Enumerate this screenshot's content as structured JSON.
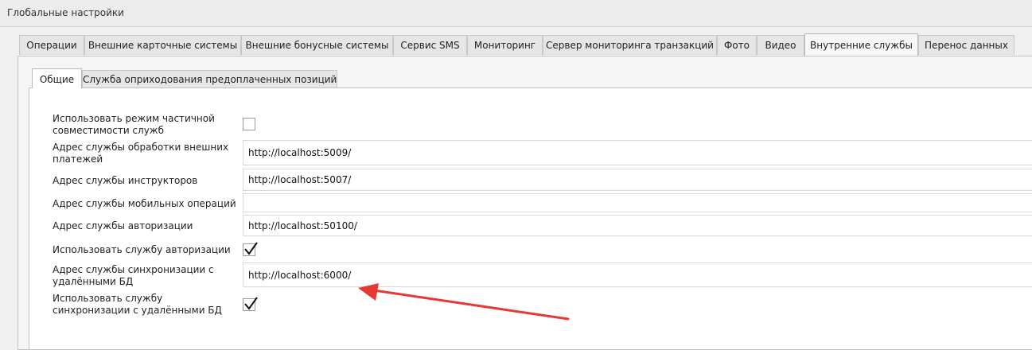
{
  "window": {
    "title": "Глобальные настройки"
  },
  "outer_tabs": [
    "Операции",
    "Внешние карточные системы",
    "Внешние бонусные системы",
    "Сервис SMS",
    "Мониторинг",
    "Сервер мониторинга транзакций",
    "Фото",
    "Видео",
    "Внутренние службы",
    "Перенос данных"
  ],
  "active_outer_tab": "Внутренние службы",
  "inner_tabs": [
    "Общие",
    "Служба оприходования предоплаченных позиций"
  ],
  "active_inner_tab": "Общие",
  "form": {
    "partial_compat": {
      "label": "Использовать режим частичной совместимости служб",
      "checked": false
    },
    "ext_payments": {
      "label": "Адрес службы обработки внешних платежей",
      "value": "http://localhost:5009/"
    },
    "instructors": {
      "label": "Адрес службы инструкторов",
      "value": "http://localhost:5007/"
    },
    "mobile_ops": {
      "label": "Адрес службы мобильных операций",
      "value": ""
    },
    "auth": {
      "label": "Адрес службы авторизации",
      "value": "http://localhost:50100/"
    },
    "use_auth": {
      "label": "Использовать службу авторизации",
      "checked": true
    },
    "sync": {
      "label": "Адрес службы синхронизации с удалёнными БД",
      "value": "http://localhost:6000/"
    },
    "use_sync": {
      "label": "Использовать службу синхронизации с удалёнными БД",
      "checked": true
    }
  },
  "colors": {
    "annotation_arrow": "#e53935"
  }
}
